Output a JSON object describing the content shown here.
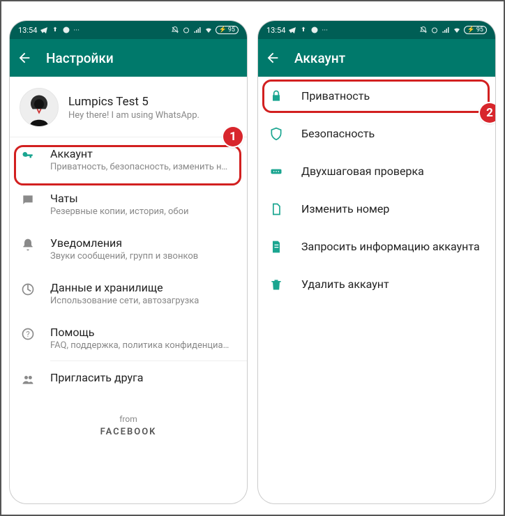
{
  "status": {
    "time": "13:54",
    "battery": "95"
  },
  "left": {
    "title": "Настройки",
    "profile": {
      "name": "Lumpics Test 5",
      "status": "Hey there! I am using WhatsApp."
    },
    "items": [
      {
        "label": "Аккаунт",
        "sub": "Приватность, безопасность, изменить номер"
      },
      {
        "label": "Чаты",
        "sub": "Резервные копии, история, обои"
      },
      {
        "label": "Уведомления",
        "sub": "Звуки сообщений, групп и звонков"
      },
      {
        "label": "Данные и хранилище",
        "sub": "Использование сети, автозагрузка"
      },
      {
        "label": "Помощь",
        "sub": "FAQ, поддержка, политика конфиденциальн…"
      },
      {
        "label": "Пригласить друга",
        "sub": null
      }
    ],
    "footer": {
      "from": "from",
      "brand": "FACEBOOK"
    }
  },
  "right": {
    "title": "Аккаунт",
    "items": [
      {
        "label": "Приватность"
      },
      {
        "label": "Безопасность"
      },
      {
        "label": "Двухшаговая проверка"
      },
      {
        "label": "Изменить номер"
      },
      {
        "label": "Запросить информацию аккаунта"
      },
      {
        "label": "Удалить аккаунт"
      }
    ]
  },
  "annotations": {
    "badge1": "1",
    "badge2": "2"
  }
}
